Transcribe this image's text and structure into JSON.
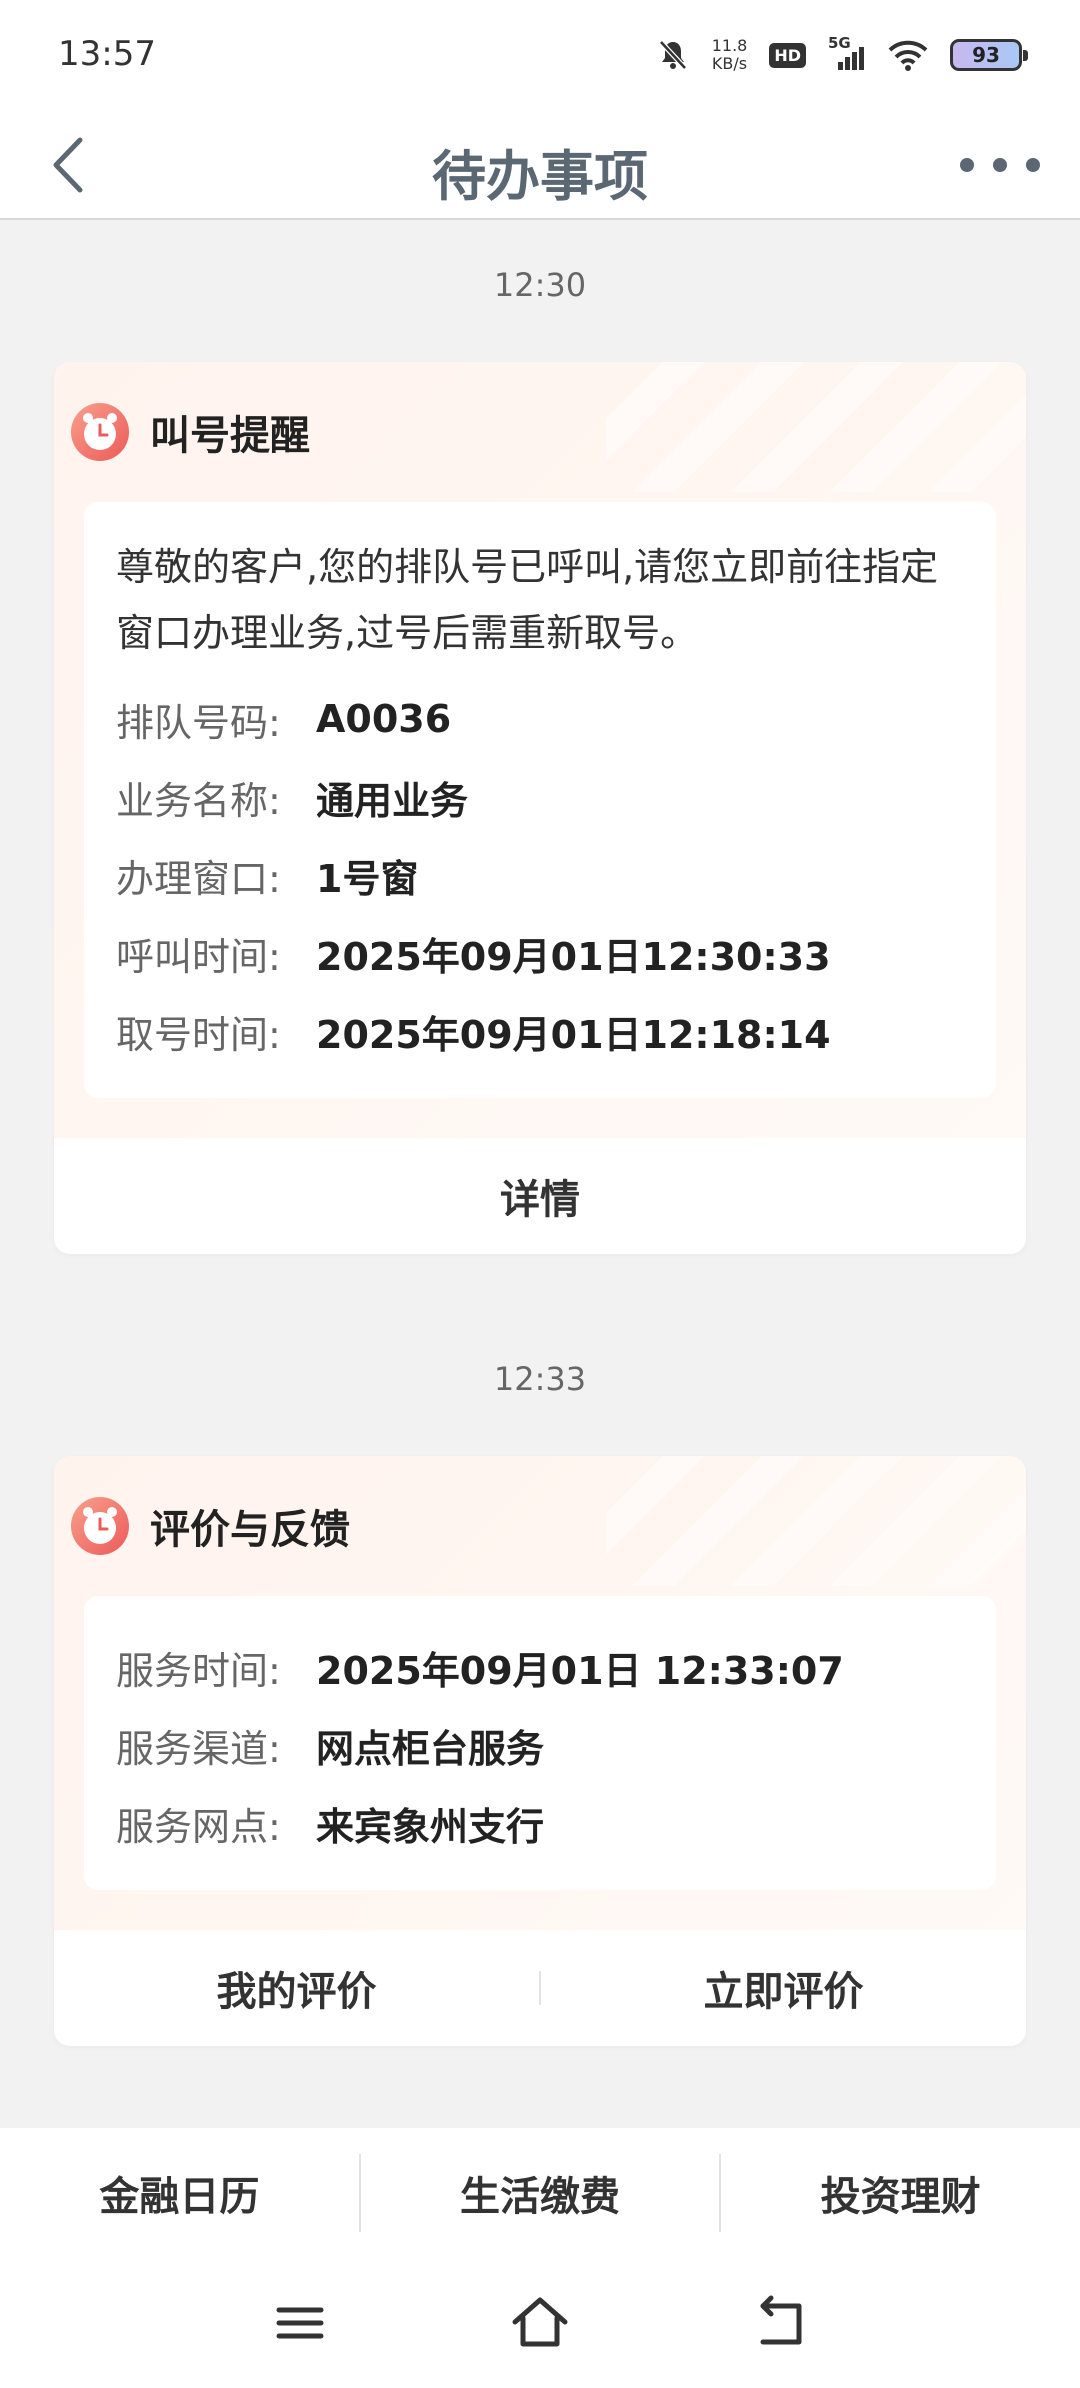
{
  "status_bar": {
    "time": "13:57",
    "net_speed_value": "11.8",
    "net_speed_unit": "KB/s",
    "hd": "HD",
    "signal": "5G",
    "battery": "93"
  },
  "nav": {
    "title": "待办事项",
    "back_icon": "chevron-left-icon",
    "more_icon": "more-icon"
  },
  "messages": [
    {
      "time": "12:30",
      "title": "叫号提醒",
      "description": "尊敬的客户,您的排队号已呼叫,请您立即前往指定窗口办理业务,过号后需重新取号。",
      "fields": [
        {
          "label": "排队号码:",
          "value": "A0036"
        },
        {
          "label": "业务名称:",
          "value": "通用业务"
        },
        {
          "label": "办理窗口:",
          "value": "1号窗"
        },
        {
          "label": "呼叫时间:",
          "value": "2025年09月01日12:30:33"
        },
        {
          "label": "取号时间:",
          "value": "2025年09月01日12:18:14"
        }
      ],
      "actions": [
        "详情"
      ]
    },
    {
      "time": "12:33",
      "title": "评价与反馈",
      "fields": [
        {
          "label": "服务时间:",
          "value": "2025年09月01日 12:33:07"
        },
        {
          "label": "服务渠道:",
          "value": "网点柜台服务"
        },
        {
          "label": "服务网点:",
          "value": "来宾象州支行"
        }
      ],
      "actions": [
        "我的评价",
        "立即评价"
      ]
    }
  ],
  "bottom_menu": [
    "金融日历",
    "生活缴费",
    "投资理财"
  ],
  "colors": {
    "accent": "#f06a5e",
    "title": "#5b6873",
    "card_bg": "#fff3ee"
  }
}
